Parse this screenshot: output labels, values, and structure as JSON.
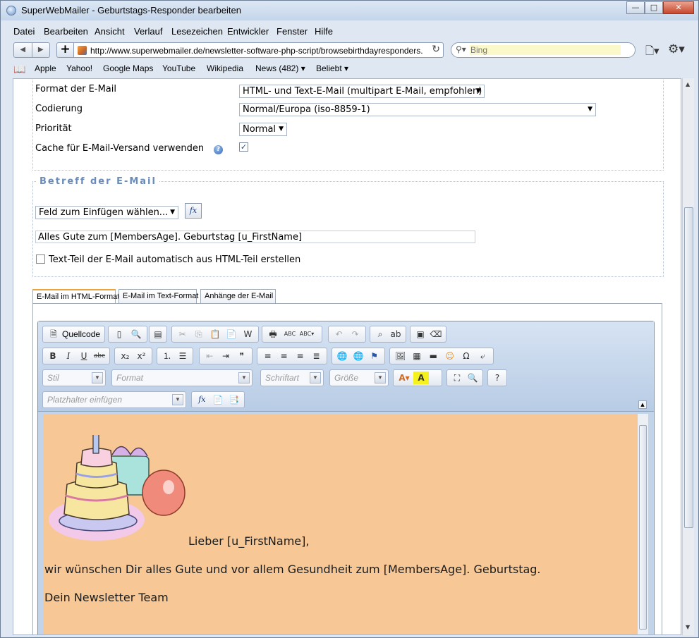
{
  "window": {
    "title": "SuperWebMailer - Geburtstags-Responder bearbeiten",
    "min": "—",
    "max": "□",
    "close": "✕"
  },
  "menu": [
    "Datei",
    "Bearbeiten",
    "Ansicht",
    "Verlauf",
    "Lesezeichen",
    "Entwickler",
    "Fenster",
    "Hilfe"
  ],
  "nav": {
    "back": "◀",
    "forward": "▶",
    "add": "+",
    "url": "http://www.superwebmailer.de/newsletter-software-php-script/browsebirthdayresponders.",
    "search_placeholder": "Bing"
  },
  "bookmarks": [
    "Apple",
    "Yahoo!",
    "Google Maps",
    "YouTube",
    "Wikipedia",
    "News (482) ▾",
    "Beliebt ▾"
  ],
  "settings": {
    "format_label": "Format der E-Mail",
    "format_value": "HTML- und Text-E-Mail (multipart E-Mail, empfohlen)",
    "encoding_label": "Codierung",
    "encoding_value": "Normal/Europa (iso-8859-1)",
    "priority_label": "Priorität",
    "priority_value": "Normal",
    "cache_label": "Cache für E-Mail-Versand verwenden",
    "cache_checked": "✓"
  },
  "subject": {
    "legend": "Betreff der E-Mail",
    "insert_field": "Feld zum Einfügen wählen...",
    "fx": "fx",
    "value": "Alles Gute zum [MembersAge]. Geburtstag [u_FirstName]",
    "auto_text_label": "Text-Teil der E-Mail automatisch aus HTML-Teil erstellen"
  },
  "tabs": [
    "E-Mail im HTML-Format",
    "E-Mail im Text-Format",
    "Anhänge der E-Mail"
  ],
  "editor": {
    "source_label": "Quellcode",
    "combos": {
      "style": "Stil",
      "format": "Format",
      "font": "Schriftart",
      "size": "Größe",
      "placeholder": "Platzhalter einfügen"
    },
    "greeting": "Lieber [u_FirstName],",
    "message": "wir wünschen Dir alles Gute und vor allem Gesundheit zum [MembersAge]. Geburtstag.",
    "signature": "Dein Newsletter Team",
    "background": "#f7c895"
  }
}
